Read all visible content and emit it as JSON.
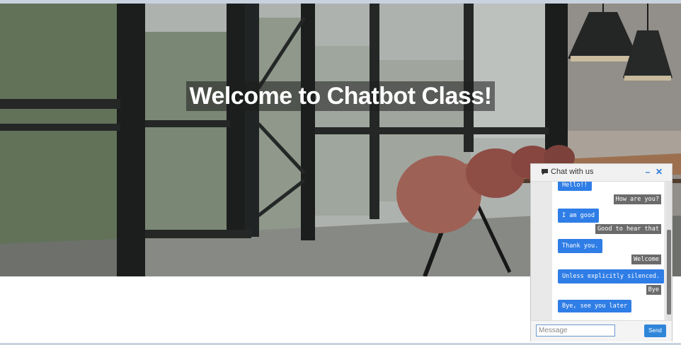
{
  "hero": {
    "title": "Welcome to Chatbot Class!"
  },
  "chat": {
    "header_title": "Chat with us",
    "header_icon": "speech-bubble-icon",
    "minimize_symbol": "–",
    "close_symbol": "✕",
    "messages": [
      {
        "from": "bot",
        "text": "Hello!!"
      },
      {
        "from": "user",
        "text": "How are you?"
      },
      {
        "from": "bot",
        "text": "I am good"
      },
      {
        "from": "user",
        "text": "Good to hear that"
      },
      {
        "from": "bot",
        "text": "Thank you."
      },
      {
        "from": "user",
        "text": "Welcome"
      },
      {
        "from": "bot",
        "text": "Unless explicitly silenced."
      },
      {
        "from": "user",
        "text": "Bye"
      },
      {
        "from": "bot",
        "text": "Bye, see you later"
      }
    ],
    "input_placeholder": "Message",
    "send_label": "Send"
  },
  "colors": {
    "bot_bubble": "#2f7de6",
    "user_bubble": "#6b6b6b",
    "accent": "#2a78d6"
  }
}
